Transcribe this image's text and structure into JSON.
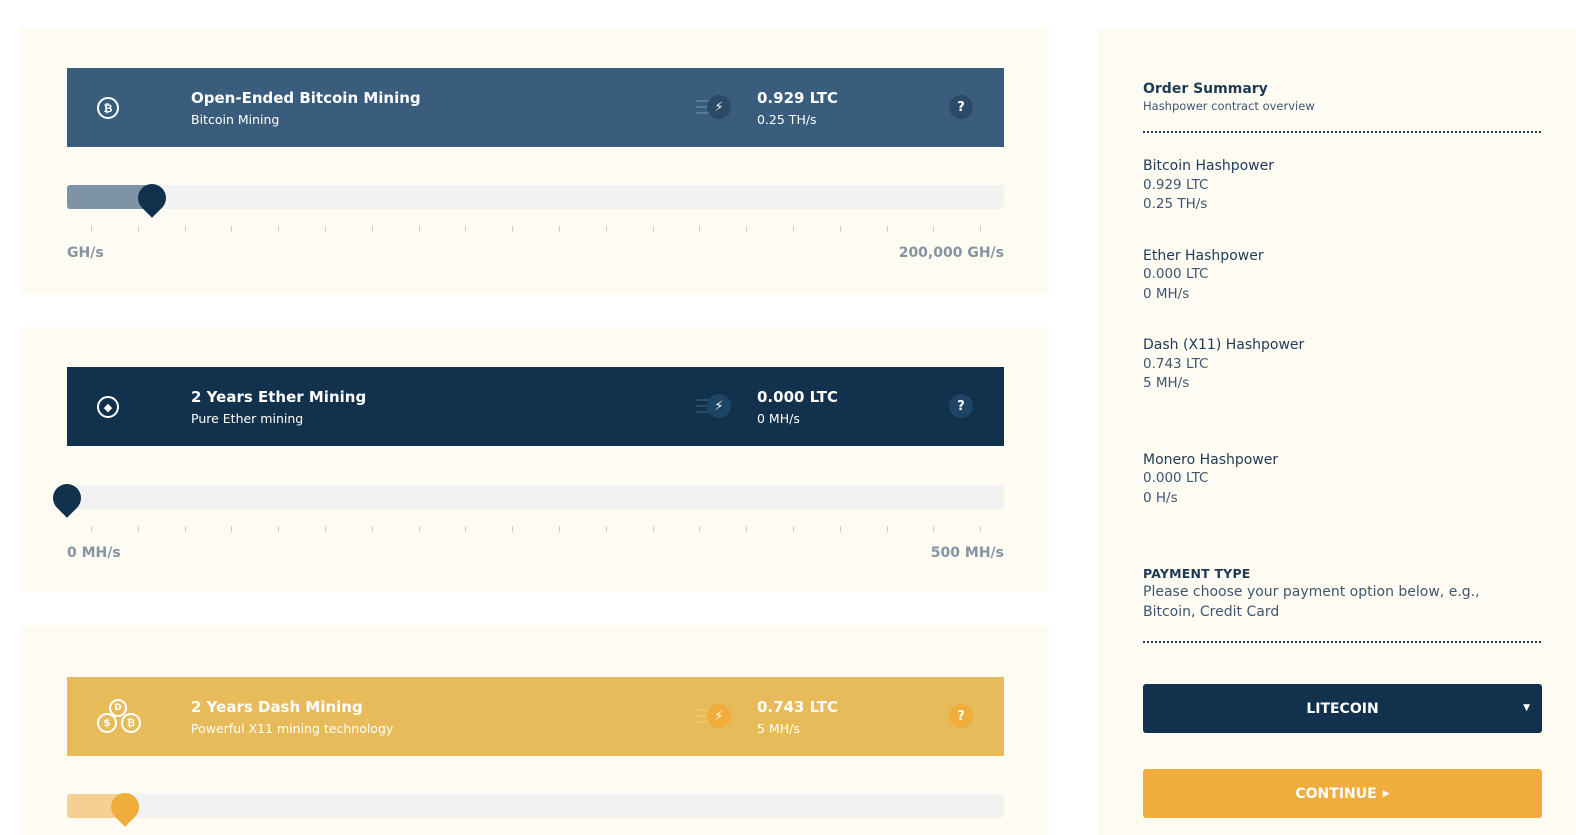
{
  "contracts": [
    {
      "title": "Open-Ended Bitcoin Mining",
      "subtitle": "Bitcoin Mining",
      "coin_icon": "bitcoin-icon",
      "coin_glyph": "₿",
      "value": "0.929 LTC",
      "rate": "0.25 TH/s",
      "help": "?",
      "min_label": "GH/s",
      "max_label": "200,000 GH/s",
      "slider_fraction": 0.09,
      "banner_color": "#3a5d7d",
      "accent_color": "#7e93a5"
    },
    {
      "title": "2 Years Ether Mining",
      "subtitle": "Pure Ether mining",
      "coin_icon": "ether-icon",
      "coin_glyph": "◆",
      "value": "0.000 LTC",
      "rate": "0 MH/s",
      "help": "?",
      "min_label": "0 MH/s",
      "max_label": "500 MH/s",
      "slider_fraction": 0.0,
      "banner_color": "#12314d",
      "accent_color": "#12314d"
    },
    {
      "title": "2 Years Dash Mining",
      "subtitle": "Powerful X11 mining technology",
      "coin_icon": "dash-coins-icon",
      "coin_glyph": "$",
      "value": "0.743 LTC",
      "rate": "5 MH/s",
      "help": "?",
      "slider_fraction": 0.062,
      "banner_color": "#e8bb5a",
      "accent_color": "#f0ad3c"
    }
  ],
  "summary": {
    "title": "Order Summary",
    "subtitle": "Hashpower contract overview",
    "items": [
      {
        "title": "Bitcoin Hashpower",
        "value": "0.929 LTC",
        "rate": "0.25 TH/s"
      },
      {
        "title": "Ether Hashpower",
        "value": "0.000 LTC",
        "rate": "0 MH/s"
      },
      {
        "title": "Dash (X11) Hashpower",
        "value": "0.743 LTC",
        "rate": "5 MH/s"
      },
      {
        "title": "Monero Hashpower",
        "value": "0.000 LTC",
        "rate": "0 H/s"
      }
    ],
    "payment_type_label": "PAYMENT TYPE",
    "payment_type_desc": "Please choose your payment option below, e.g., Bitcoin, Credit Card",
    "payment_selected": "LITECOIN",
    "continue_label": "CONTINUE"
  },
  "colors": {
    "navy": "#12314d",
    "gold": "#f0ad3c",
    "panel": "#fefbf3"
  }
}
